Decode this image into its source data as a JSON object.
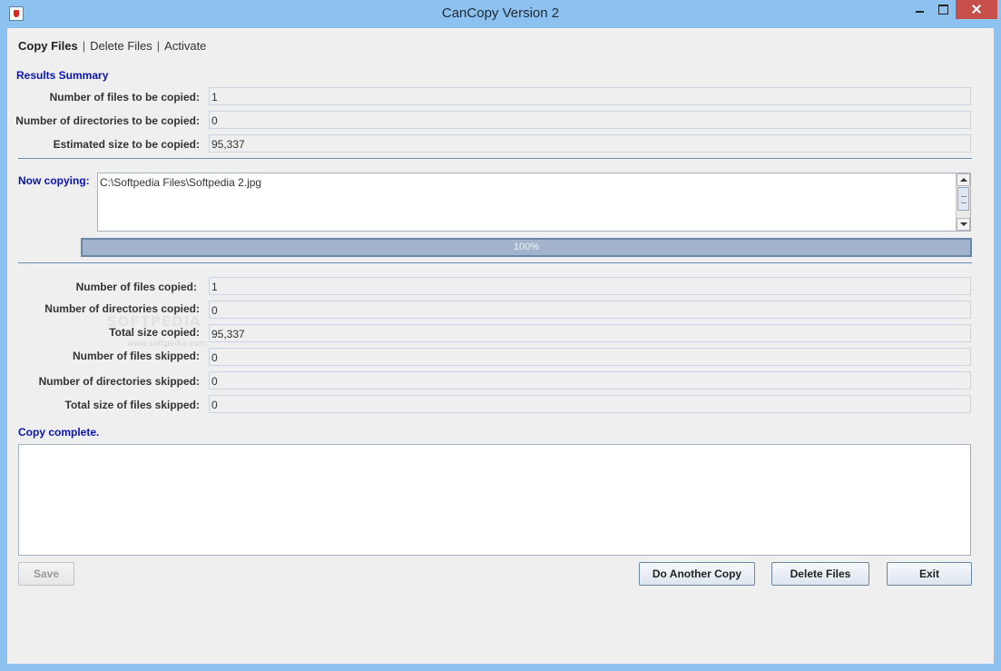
{
  "window": {
    "title": "CanCopy Version 2"
  },
  "menu": {
    "items": [
      {
        "label": "Copy Files",
        "active": true
      },
      {
        "label": "Delete Files",
        "active": false
      },
      {
        "label": "Activate",
        "active": false
      }
    ],
    "separator": "|"
  },
  "results_summary": {
    "heading": "Results Summary",
    "rows": [
      {
        "label": "Number of files to be copied:",
        "value": "1"
      },
      {
        "label": "Number of directories to be copied:",
        "value": "0"
      },
      {
        "label": "Estimated size to be copied:",
        "value": "95,337"
      }
    ]
  },
  "now_copying": {
    "label": "Now copying:",
    "text": "C:\\Softpedia Files\\Softpedia 2.jpg"
  },
  "progress": {
    "percent": 100,
    "label": "100%"
  },
  "copied_stats": {
    "rows": [
      {
        "label": "Number of files copied:",
        "value": "1"
      },
      {
        "label": "Number of directories copied:",
        "value": "0"
      },
      {
        "label": "Total size copied:",
        "value": "95,337"
      },
      {
        "label": "Number of files skipped:",
        "value": "0"
      },
      {
        "label": "Number of directories skipped:",
        "value": "0"
      },
      {
        "label": "Total size of files skipped:",
        "value": "0"
      }
    ]
  },
  "status": {
    "message": "Copy complete.",
    "log_text": ""
  },
  "buttons": {
    "save": "Save",
    "do_another_copy": "Do Another Copy",
    "delete_files": "Delete Files",
    "exit": "Exit"
  },
  "watermark": {
    "text": "SOFTPEDIA",
    "sub": "www.softpedia.com"
  }
}
